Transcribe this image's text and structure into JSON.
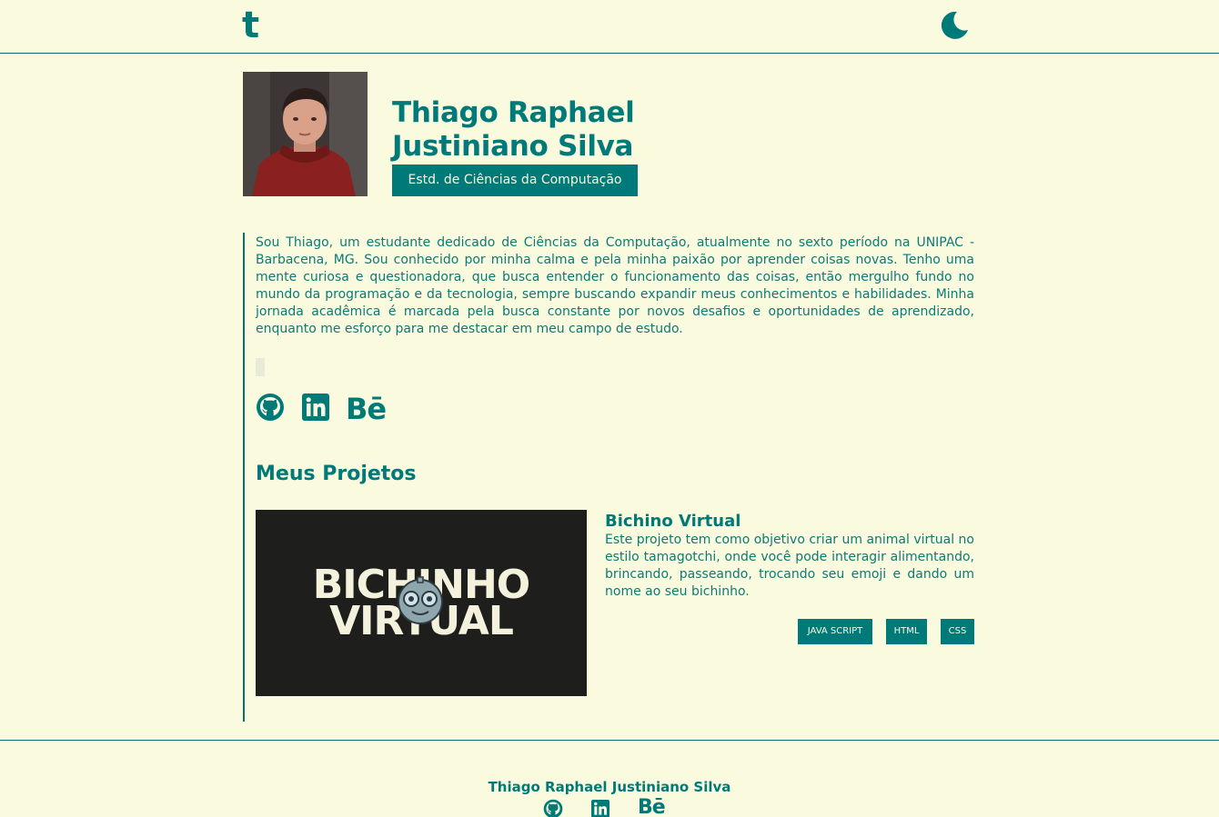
{
  "header": {
    "logo_text": "t",
    "theme_toggle_icon": "moon-icon"
  },
  "profile": {
    "name": "Thiago Raphael Justiniano Silva",
    "role": "Estd. de Ciências da Computação",
    "avatar_icon": "profile-photo"
  },
  "bio": "Sou Thiago, um estudante dedicado de Ciências da Computação, atualmente no sexto período na UNIPAC - Barbacena, MG. Sou conhecido por minha calma e pela minha paixão por aprender coisas novas. Tenho uma mente curiosa e questionadora, que busca entender o funcionamento das coisas, então mergulho fundo no mundo da programação e da tecnologia, sempre buscando expandir meus conhecimentos e habilidades. Minha jornada acadêmica é marcada pela busca constante por novos desafios e oportunidades de aprendizado, enquanto me esforço para me destacar em meu campo de estudo.",
  "social": {
    "github_icon": "github-icon",
    "linkedin_icon": "linkedin-icon",
    "behance_label": "Bē"
  },
  "projects_section": {
    "title": "Meus Projetos",
    "projects": [
      {
        "image_text_line1": "BICHINHO",
        "image_text_line2": "VIRTUAL",
        "title": "Bichino Virtual",
        "description": "Este projeto tem como objetivo criar um animal virtual no estilo tamagotchi, onde você pode interagir alimentando, brincando, passeando, trocando seu emoji e dando um nome ao seu bichinho.",
        "tags": [
          "JAVA SCRIPT",
          "HTML",
          "CSS"
        ]
      }
    ]
  },
  "footer": {
    "name": "Thiago Raphael Justiniano Silva",
    "behance_label": "Bē"
  },
  "colors": {
    "background": "#fafadf",
    "accent": "#007a78",
    "project_image_bg": "#1e1e1c"
  }
}
